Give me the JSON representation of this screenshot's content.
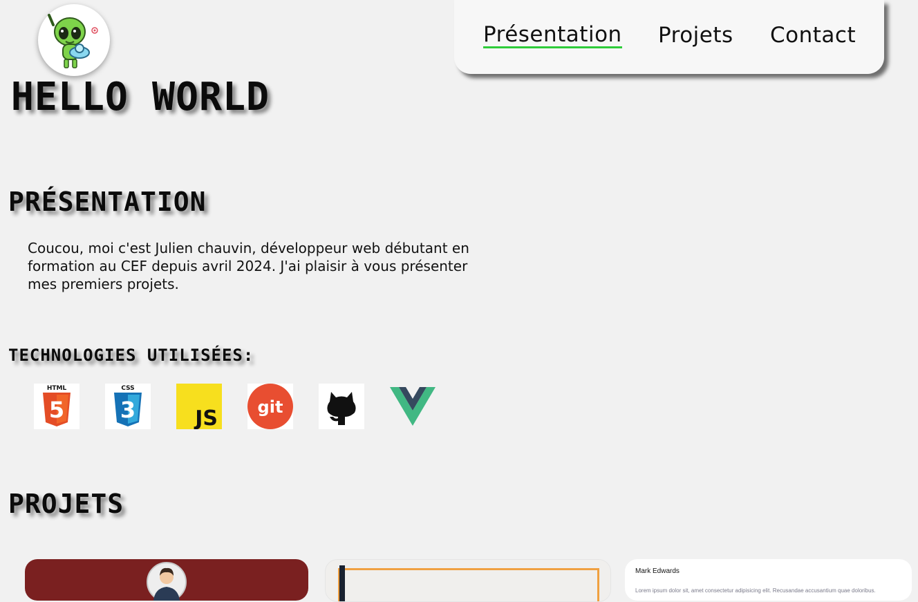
{
  "nav": {
    "items": [
      {
        "label": "Présentation",
        "active": true
      },
      {
        "label": "Projets",
        "active": false
      },
      {
        "label": "Contact",
        "active": false
      }
    ]
  },
  "hero": {
    "title": "HELLO WORLD",
    "logo_icon": "alien-mascot-icon"
  },
  "presentation": {
    "heading": "PRÉSENTATION",
    "text": "Coucou, moi c'est Julien chauvin, développeur web débutant en formation au CEF depuis avril 2024. J'ai plaisir à vous présenter mes premiers projets."
  },
  "technologies": {
    "heading": "TECHNOLOGIES UTILISÉES:",
    "items": [
      {
        "icon": "html5-icon",
        "label_top": "HTML",
        "glyph": "5"
      },
      {
        "icon": "css3-icon",
        "label_top": "CSS",
        "glyph": "3"
      },
      {
        "icon": "javascript-icon",
        "glyph": "JS"
      },
      {
        "icon": "git-icon",
        "glyph": "git"
      },
      {
        "icon": "github-icon"
      },
      {
        "icon": "vue-icon"
      }
    ]
  },
  "projects": {
    "heading": "PROJETS",
    "cards": [
      {
        "preview": "profile-card"
      },
      {
        "preview": "framed-page"
      },
      {
        "name": "Mark Edwards",
        "text": "Lorem ipsum dolor sit, amet consectetur adipisicing elit. Recusandae accusantium quae doloribus."
      }
    ]
  },
  "colors": {
    "accent": "#2ecc3a",
    "background": "#f1f1f1",
    "card1": "#7a2020",
    "frame": "#f0a040"
  }
}
